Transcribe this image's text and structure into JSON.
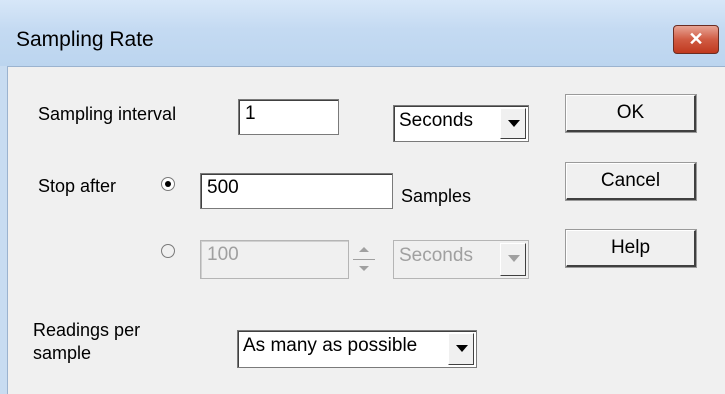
{
  "window": {
    "title": "Sampling Rate",
    "close_glyph": "✕"
  },
  "interval": {
    "label": "Sampling interval",
    "value": "1",
    "unit": "Seconds"
  },
  "stop": {
    "label": "Stop after",
    "samples_value": "500",
    "samples_label": "Samples",
    "time_value": "100",
    "time_unit": "Seconds",
    "samples_selected": true
  },
  "readings": {
    "label_line1": "Readings per",
    "label_line2": "sample",
    "value": "As many as possible"
  },
  "buttons": {
    "ok": "OK",
    "cancel": "Cancel",
    "help": "Help"
  },
  "colors": {
    "title_bar": "#c4daf2",
    "close_button": "#d05b43",
    "dialog_bg": "#f0f0f0"
  }
}
